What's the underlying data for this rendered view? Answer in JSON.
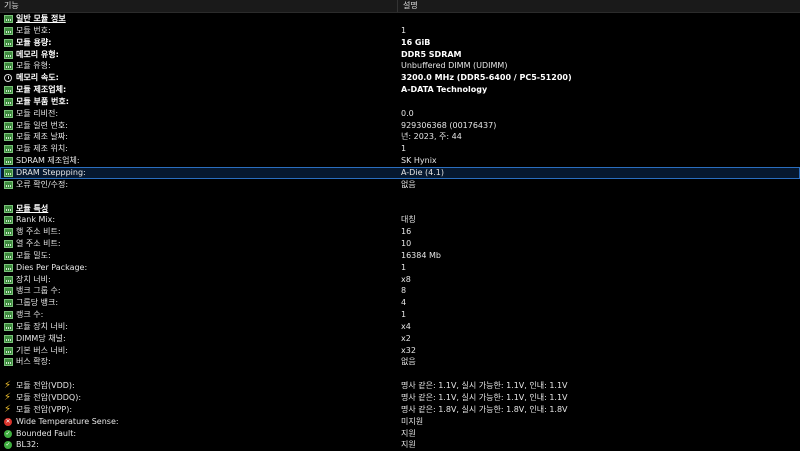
{
  "header": {
    "col_feature": "기능",
    "col_description": "설명"
  },
  "rows": [
    {
      "type": "section",
      "icon": "memory-module-icon",
      "label": "일반 모듈 정보",
      "value": ""
    },
    {
      "icon": "memory-module-icon",
      "label": "모듈 번호:",
      "value": "1"
    },
    {
      "icon": "memory-module-icon",
      "label": "모듈 용량:",
      "value": "16 GiB",
      "bold": true
    },
    {
      "icon": "memory-module-icon",
      "label": "메모리 유형:",
      "value": "DDR5 SDRAM",
      "bold": true
    },
    {
      "icon": "memory-module-icon",
      "label": "모듈 유형:",
      "value": "Unbuffered DIMM (UDIMM)"
    },
    {
      "icon": "clock-icon",
      "label": "메모리 속도:",
      "value": "3200.0 MHz (DDR5-6400 / PC5-51200)",
      "bold": true
    },
    {
      "icon": "memory-module-icon",
      "label": "모듈 제조업체:",
      "value": "A-DATA Technology",
      "bold": true
    },
    {
      "icon": "memory-module-icon",
      "label": "모듈 부품 번호:",
      "value": "",
      "bold": true
    },
    {
      "icon": "memory-module-icon",
      "label": "모듈 리비전:",
      "value": "0.0"
    },
    {
      "icon": "memory-module-icon",
      "label": "모듈 일련 번호:",
      "value": "929306368 (00176437)"
    },
    {
      "icon": "memory-module-icon",
      "label": "모듈 제조 날짜:",
      "value": "년: 2023, 주: 44"
    },
    {
      "icon": "memory-module-icon",
      "label": "모듈 제조 위치:",
      "value": "1"
    },
    {
      "icon": "memory-module-icon",
      "label": "SDRAM 제조업체:",
      "value": "SK Hynix"
    },
    {
      "icon": "memory-module-icon",
      "label": "DRAM Steppping:",
      "value": "A-Die (4.1)",
      "selected": true
    },
    {
      "icon": "memory-module-icon",
      "label": "오류 확인/수정:",
      "value": "없음"
    },
    {
      "type": "blank"
    },
    {
      "type": "section",
      "icon": "memory-module-icon",
      "label": "모듈 특성",
      "value": ""
    },
    {
      "icon": "memory-module-icon",
      "label": "Rank Mix:",
      "value": "대칭"
    },
    {
      "icon": "memory-module-icon",
      "label": "행 주소 비트:",
      "value": "16"
    },
    {
      "icon": "memory-module-icon",
      "label": "열 주소 비트:",
      "value": "10"
    },
    {
      "icon": "memory-module-icon",
      "label": "모듈 밀도:",
      "value": "16384 Mb"
    },
    {
      "icon": "memory-module-icon",
      "label": "Dies Per Package:",
      "value": "1"
    },
    {
      "icon": "memory-module-icon",
      "label": "장치 너비:",
      "value": "x8"
    },
    {
      "icon": "memory-module-icon",
      "label": "뱅크 그룹 수:",
      "value": "8"
    },
    {
      "icon": "memory-module-icon",
      "label": "그룹당 뱅크:",
      "value": "4"
    },
    {
      "icon": "memory-module-icon",
      "label": "랭크 수:",
      "value": "1"
    },
    {
      "icon": "memory-module-icon",
      "label": "모듈 장치 너비:",
      "value": "x4"
    },
    {
      "icon": "memory-module-icon",
      "label": "DIMM당 채널:",
      "value": "x2"
    },
    {
      "icon": "memory-module-icon",
      "label": "기본 버스 너비:",
      "value": "x32"
    },
    {
      "icon": "memory-module-icon",
      "label": "버스 확장:",
      "value": "없음"
    },
    {
      "type": "blank"
    },
    {
      "icon": "lightning-bolt-icon",
      "label": "모듈 전압(VDD):",
      "value": "명사 같은: 1.1V, 실시 가능한: 1.1V, 인내: 1.1V"
    },
    {
      "icon": "lightning-bolt-icon",
      "label": "모듈 전압(VDDQ):",
      "value": "명사 같은: 1.1V, 실시 가능한: 1.1V, 인내: 1.1V"
    },
    {
      "icon": "lightning-bolt-icon",
      "label": "모듈 전압(VPP):",
      "value": "명사 같은: 1.8V, 실시 가능한: 1.8V, 인내: 1.8V"
    },
    {
      "icon": "unsupported-x-icon",
      "label": "Wide Temperature Sense:",
      "value": "미지원"
    },
    {
      "icon": "supported-check-icon",
      "label": "Bounded Fault:",
      "value": "지원"
    },
    {
      "icon": "supported-check-icon",
      "label": "BL32:",
      "value": "지원"
    }
  ]
}
